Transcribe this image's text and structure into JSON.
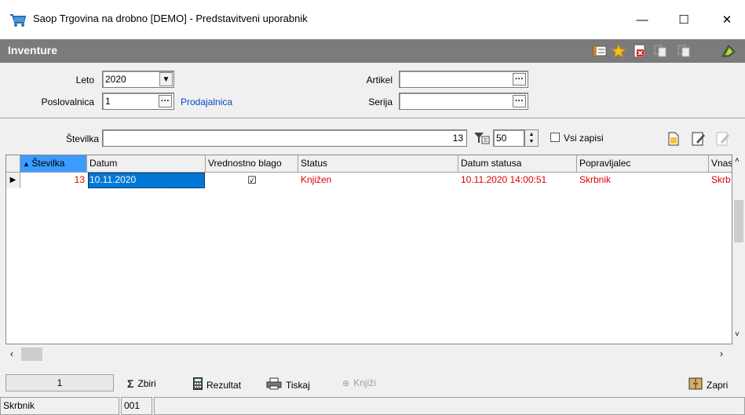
{
  "window": {
    "title": "Saop Trgovina na drobno [DEMO] - Predstavitveni uporabnik",
    "minimize": "—",
    "maximize": "☐",
    "close": "✕"
  },
  "module": {
    "title": "Inventure"
  },
  "filters": {
    "leto_label": "Leto",
    "leto_value": "2020",
    "poslovalnica_label": "Poslovalnica",
    "poslovalnica_value": "1",
    "poslovalnica_name": "Prodajalnica",
    "artikel_label": "Artikel",
    "artikel_value": "",
    "serija_label": "Serija",
    "serija_value": ""
  },
  "search": {
    "stevilka_label": "Številka",
    "stevilka_value": "13",
    "limit_value": "50",
    "vsi_zapisi_label": "Vsi zapisi"
  },
  "grid": {
    "columns": [
      "Številka",
      "Datum",
      "Vrednostno blago",
      "Status",
      "Datum statusa",
      "Popravljalec",
      "Vnas"
    ],
    "rows": [
      {
        "stevilka": "13",
        "datum": "10.11.2020",
        "vrednostno_blago": "☑",
        "status": "Knjižen",
        "datum_statusa": "10.11.2020 14:00:51",
        "popravljalec": "Skrbnik",
        "vnasalec": "Skrb"
      }
    ]
  },
  "bottom": {
    "count": "1",
    "zbiri": "Zbiri",
    "rezultat": "Rezultat",
    "tiskaj": "Tiskaj",
    "knjizi": "Knjiži",
    "zapri": "Zapri"
  },
  "statusbar": {
    "user": "Skrbnik",
    "code": "001"
  },
  "colors": {
    "header_bg": "#7b7b7b",
    "selection": "#0078d7",
    "status_red": "#e00000",
    "link_blue": "#0b46c4"
  }
}
